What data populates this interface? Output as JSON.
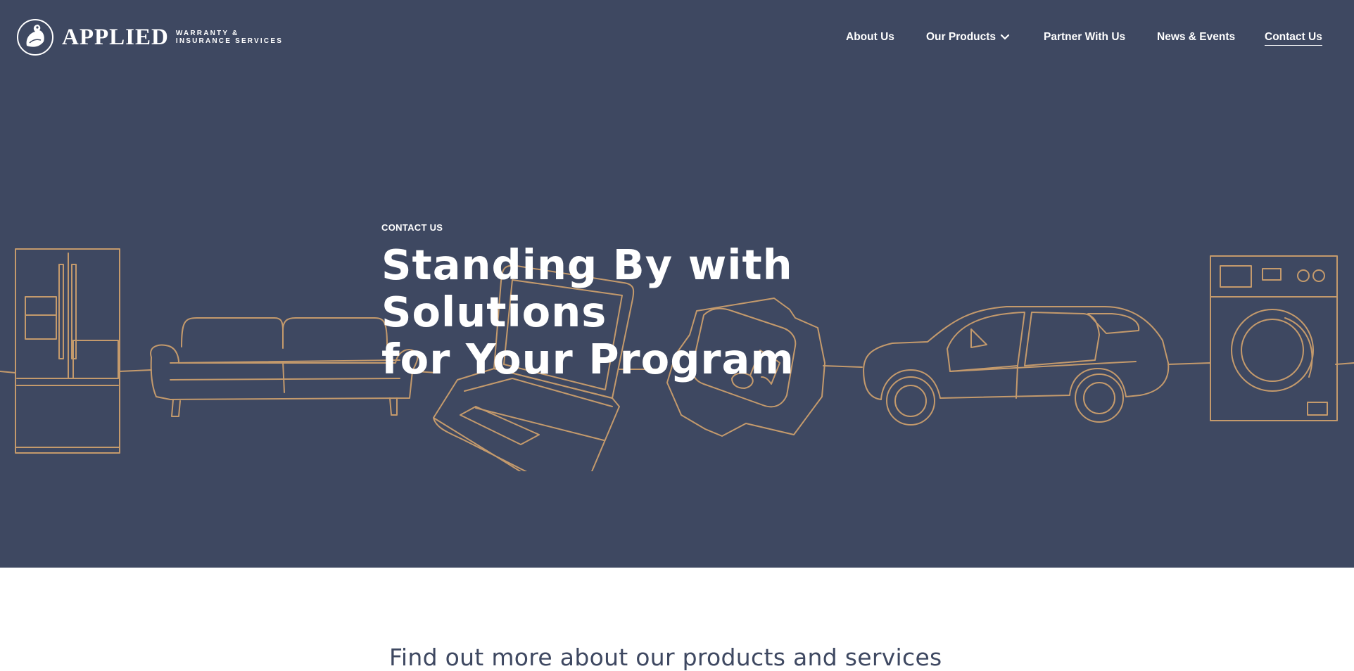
{
  "brand": {
    "wordmark": "APPLIED",
    "tagline_line1": "WARRANTY &",
    "tagline_line2": "INSURANCE SERVICES",
    "icon": "eagle-globe-logo"
  },
  "nav": {
    "items": [
      {
        "label": "About Us",
        "active": false
      },
      {
        "label": "Our Products",
        "active": false,
        "icon": "chevron-down-icon"
      },
      {
        "label": "Partner With Us",
        "active": false
      },
      {
        "label": "News & Events",
        "active": false
      },
      {
        "label": "Contact Us",
        "active": true
      }
    ]
  },
  "hero": {
    "eyebrow": "CONTACT US",
    "headline_line1": "Standing By with Solutions",
    "headline_line2": "for Your Program",
    "illustration_items": [
      "refrigerator",
      "sofa",
      "laptop",
      "music-ticket",
      "car",
      "washing-machine"
    ]
  },
  "section": {
    "heading": "Find out more about our products and services"
  },
  "colors": {
    "hero_bg": "#3e4861",
    "line_art": "#c49a6c",
    "text_light": "#ffffff",
    "heading_dark": "#3e4861"
  }
}
